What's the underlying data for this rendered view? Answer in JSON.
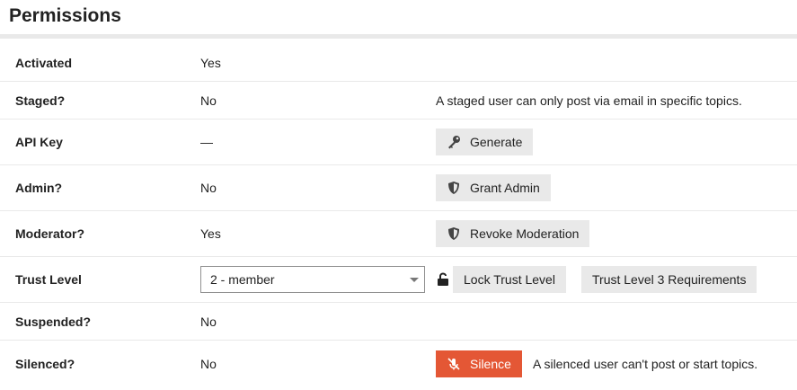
{
  "section": {
    "title": "Permissions"
  },
  "rows": {
    "activated": {
      "label": "Activated",
      "value": "Yes"
    },
    "staged": {
      "label": "Staged?",
      "value": "No",
      "note": "A staged user can only post via email in specific topics."
    },
    "api_key": {
      "label": "API Key",
      "value": "—",
      "button": "Generate",
      "icon": "key-icon"
    },
    "admin": {
      "label": "Admin?",
      "value": "No",
      "button": "Grant Admin",
      "icon": "shield-icon"
    },
    "moderator": {
      "label": "Moderator?",
      "value": "Yes",
      "button": "Revoke Moderation",
      "icon": "shield-icon"
    },
    "trust_level": {
      "label": "Trust Level",
      "selected": "2 - member",
      "lock_button": "Lock Trust Level",
      "requirements_button": "Trust Level 3 Requirements",
      "icon": "unlock-icon"
    },
    "suspended": {
      "label": "Suspended?",
      "value": "No"
    },
    "silenced": {
      "label": "Silenced?",
      "value": "No",
      "button": "Silence",
      "note": "A silenced user can't post or start topics.",
      "icon": "microphone-slash-icon"
    }
  },
  "colors": {
    "danger": "#e45735",
    "button_bg": "#e9e9e9",
    "divider": "#e9e9e9",
    "text": "#222222"
  }
}
